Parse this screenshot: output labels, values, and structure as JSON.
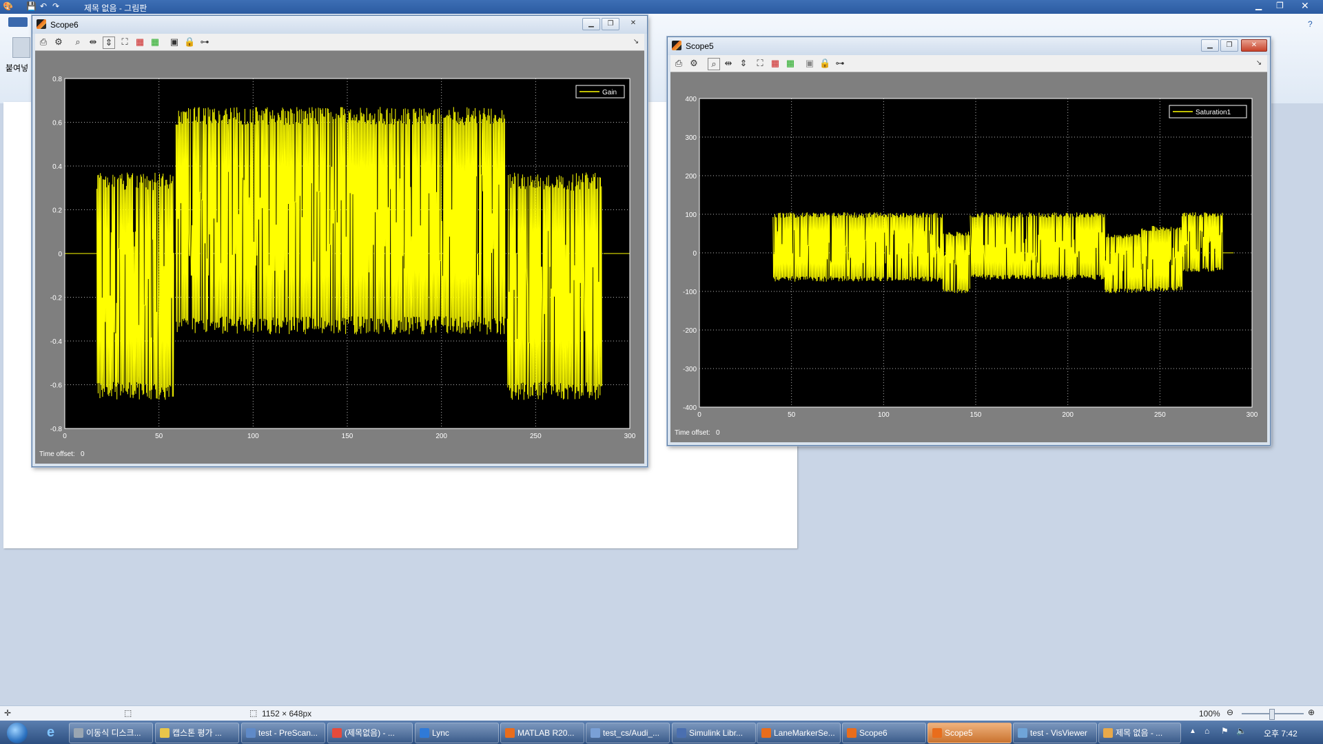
{
  "paint": {
    "title": "제목 없음 - 그림판",
    "clipboard_label": "붙여넣",
    "status_size": "1152 × 648px",
    "zoom": "100%"
  },
  "scope6": {
    "title": "Scope6",
    "time_offset_label": "Time offset:",
    "time_offset_value": "0",
    "chart_data": {
      "type": "line",
      "title": "",
      "xlim": [
        0,
        300
      ],
      "ylim": [
        -0.8,
        0.8
      ],
      "xticks": [
        0,
        50,
        100,
        150,
        200,
        250,
        300
      ],
      "yticks": [
        0.8,
        0.6,
        0.4,
        0.2,
        0,
        -0.2,
        -0.4,
        -0.6,
        -0.8
      ],
      "ytick_labels": [
        "0.8",
        "0.6",
        "0.4",
        "0.2",
        "0",
        "-0.2",
        "-0.4",
        "-0.6",
        "-0.8"
      ],
      "grid": true,
      "legend": "top-right",
      "background": "#000000",
      "series": [
        {
          "name": "Gain",
          "color": "#ffff00",
          "envelope": [
            {
              "x_start": 0,
              "x_end": 17,
              "low": 0,
              "high": 0
            },
            {
              "x_start": 17,
              "x_end": 58,
              "low": -0.67,
              "high": 0.37
            },
            {
              "x_start": 59,
              "x_end": 234,
              "low": -0.37,
              "high": 0.67
            },
            {
              "x_start": 235,
              "x_end": 285,
              "low": -0.67,
              "high": 0.37
            },
            {
              "x_start": 286,
              "x_end": 300,
              "low": 0,
              "high": 0
            }
          ]
        }
      ]
    }
  },
  "scope5": {
    "title": "Scope5",
    "time_offset_label": "Time offset:",
    "time_offset_value": "0",
    "chart_data": {
      "type": "line",
      "title": "",
      "xlim": [
        0,
        300
      ],
      "ylim": [
        -400,
        400
      ],
      "xticks": [
        0,
        50,
        100,
        150,
        200,
        250,
        300
      ],
      "yticks": [
        400,
        300,
        200,
        100,
        0,
        -100,
        -200,
        -300,
        -400
      ],
      "ytick_labels": [
        "400",
        "300",
        "200",
        "100",
        "0",
        "-100",
        "-200",
        "-300",
        "-400"
      ],
      "grid": true,
      "legend": "top-right",
      "background": "#000000",
      "series": [
        {
          "name": "Saturation1",
          "color": "#ffff00",
          "envelope": [
            {
              "x_start": 40,
              "x_end": 132,
              "low": -75,
              "high": 105
            },
            {
              "x_start": 132,
              "x_end": 147,
              "low": -105,
              "high": 55
            },
            {
              "x_start": 147,
              "x_end": 220,
              "low": -70,
              "high": 105
            },
            {
              "x_start": 220,
              "x_end": 240,
              "low": -105,
              "high": 50
            },
            {
              "x_start": 240,
              "x_end": 262,
              "low": -100,
              "high": 70
            },
            {
              "x_start": 262,
              "x_end": 284,
              "low": -50,
              "high": 105
            },
            {
              "x_start": 284,
              "x_end": 290,
              "low": 0,
              "high": 0
            }
          ]
        }
      ]
    }
  },
  "taskbar": {
    "items": [
      {
        "label": "이동식 디스크...",
        "color": "#9aa6b2"
      },
      {
        "label": "캡스톤 평가 ...",
        "color": "#e8c64a"
      },
      {
        "label": "test - PreScan...",
        "color": "#5f8ac8"
      },
      {
        "label": "(제목없음) - ...",
        "color": "#e54b3c"
      },
      {
        "label": "Lync",
        "color": "#2f7ad8"
      },
      {
        "label": "MATLAB R20...",
        "color": "#e96d1c"
      },
      {
        "label": "test_cs/Audi_...",
        "color": "#7aa0d6"
      },
      {
        "label": "Simulink Libr...",
        "color": "#4a6fb0"
      },
      {
        "label": "LaneMarkerSe...",
        "color": "#e96d1c"
      },
      {
        "label": "Scope6",
        "color": "#e96d1c"
      },
      {
        "label": "Scope5",
        "color": "#e96d1c"
      },
      {
        "label": "test - VisViewer",
        "color": "#6fa4d8"
      },
      {
        "label": "제목 없음 - ...",
        "color": "#e8a94a"
      }
    ],
    "clock": "오후 7:42"
  }
}
